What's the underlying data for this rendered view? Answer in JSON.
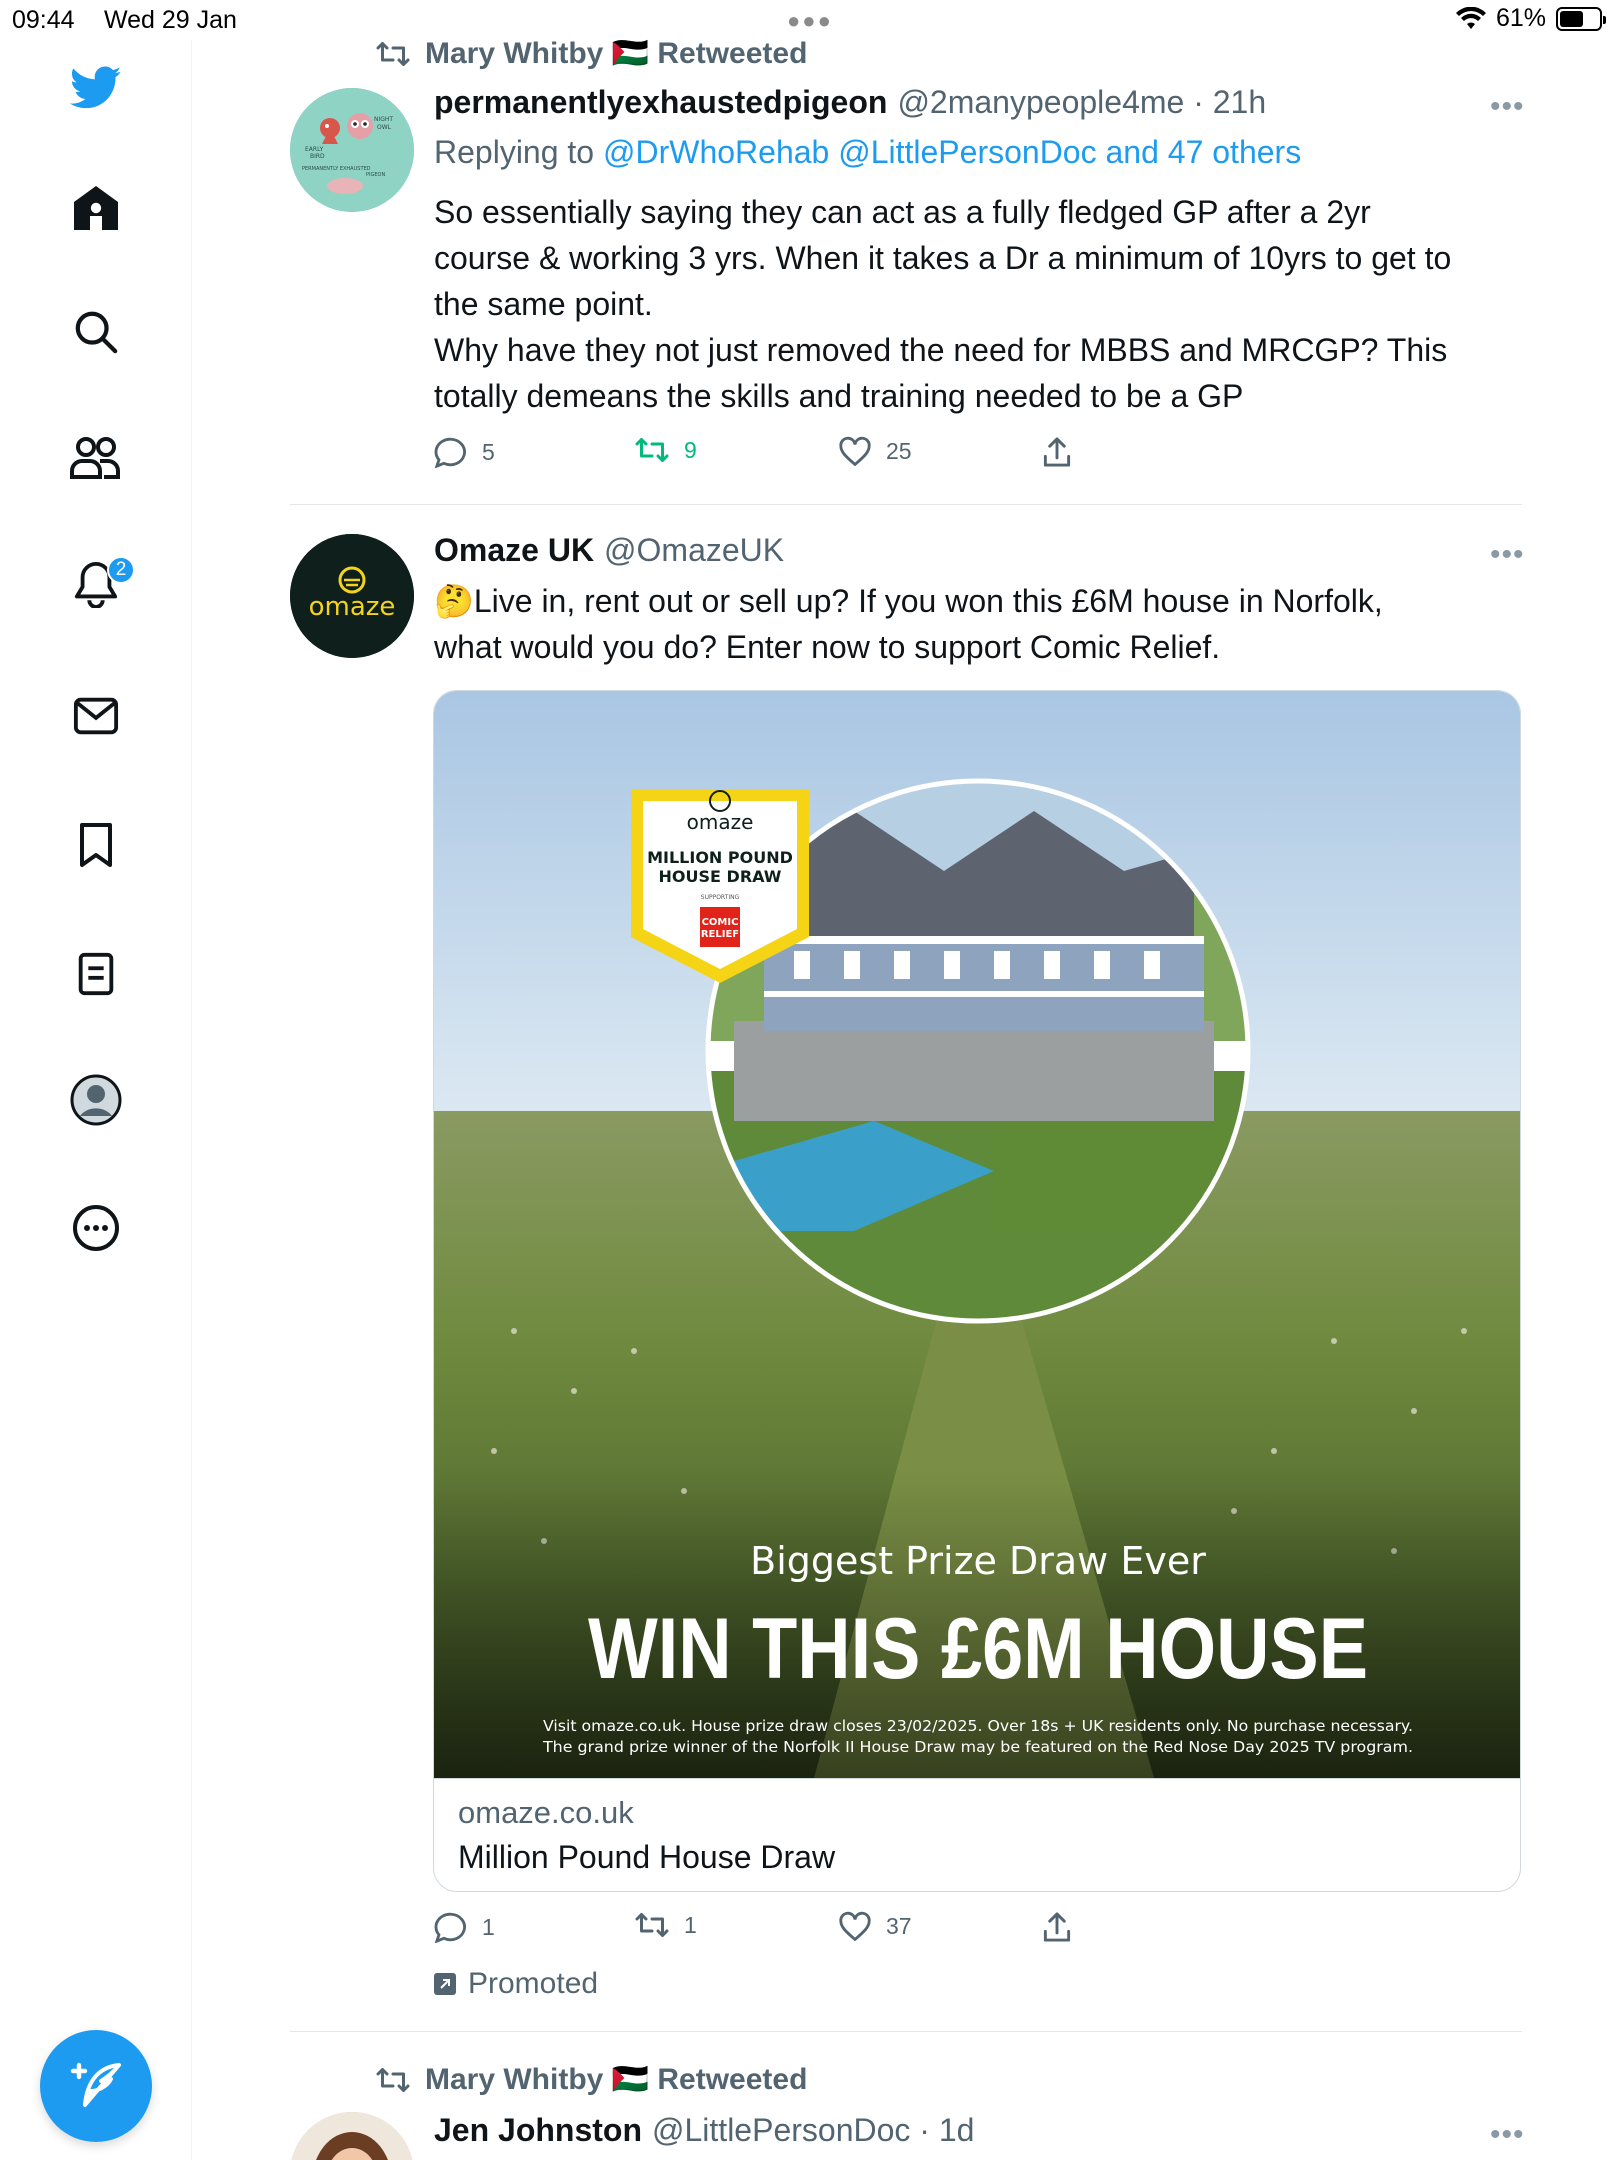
{
  "status_bar": {
    "time": "09:44",
    "date": "Wed 29 Jan",
    "battery": "61%",
    "battery_level": 0.61
  },
  "sidebar": {
    "notifications_badge": "2",
    "items": [
      {
        "name": "twitter-logo-icon"
      },
      {
        "name": "home-icon"
      },
      {
        "name": "search-icon"
      },
      {
        "name": "communities-icon"
      },
      {
        "name": "notifications-icon"
      },
      {
        "name": "messages-icon"
      },
      {
        "name": "bookmarks-icon"
      },
      {
        "name": "lists-icon"
      },
      {
        "name": "profile-icon"
      },
      {
        "name": "more-icon"
      }
    ],
    "compose_icon": "compose-icon"
  },
  "colors": {
    "accent": "#1d9bf0",
    "retweet_green": "#00ba7c",
    "muted": "#536471"
  },
  "tweets": [
    {
      "retweeted_by": "Mary Whitby 🇵🇸 Retweeted",
      "name": "permanentlyexhaustedpigeon",
      "handle": "@2manypeople4me · 21h",
      "replying_prefix": "Replying to",
      "replying_links": "@DrWhoRehab @LittlePersonDoc and 47 others",
      "avatar_labels": {
        "early_bird": "EARLY BIRD",
        "night_owl": "NIGHT OWL",
        "pigeon": "PERMANENTLY EXHAUSTED PIGEON"
      },
      "text_lines": [
        "So essentially saying they can act as a fully fledged GP after a 2yr",
        "course & working 3 yrs. When it takes a Dr a minimum of 10yrs to get to",
        "the same point.",
        "Why have they not just removed the need for MBBS and MRCGP? This",
        "totally demeans the skills and training needed to be a GP"
      ],
      "replies": "5",
      "retweets": "9",
      "likes": "25"
    },
    {
      "name": "Omaze UK",
      "handle": "@OmazeUK",
      "avatar_text": "omaze",
      "text_lines": [
        "🤔Live in, rent out or sell up? If you won this £6M house in Norfolk,",
        "what would you do? Enter now to support Comic Relief."
      ],
      "media": {
        "badge_brand": "omaze",
        "badge_title_1": "MILLION POUND",
        "badge_title_2": "HOUSE DRAW",
        "badge_supporting": "SUPPORTING",
        "badge_charity_1": "COMIC",
        "badge_charity_2": "RELIEF",
        "headline_small": "Biggest Prize Draw Ever",
        "headline_big": "WIN THIS £6M HOUSE",
        "fine_print_1": "Visit omaze.co.uk. House prize draw closes 23/02/2025. Over 18s + UK residents only. No purchase necessary.",
        "fine_print_2": "The grand prize winner of the Norfolk II House Draw may be featured on the Red Nose Day 2025 TV program."
      },
      "card_domain": "omaze.co.uk",
      "card_title": "Million Pound House Draw",
      "replies": "1",
      "retweets": "1",
      "likes": "37",
      "promoted": "Promoted"
    },
    {
      "retweeted_by": "Mary Whitby 🇵🇸 Retweeted",
      "name": "Jen Johnston",
      "handle": "@LittlePersonDoc · 1d"
    }
  ]
}
